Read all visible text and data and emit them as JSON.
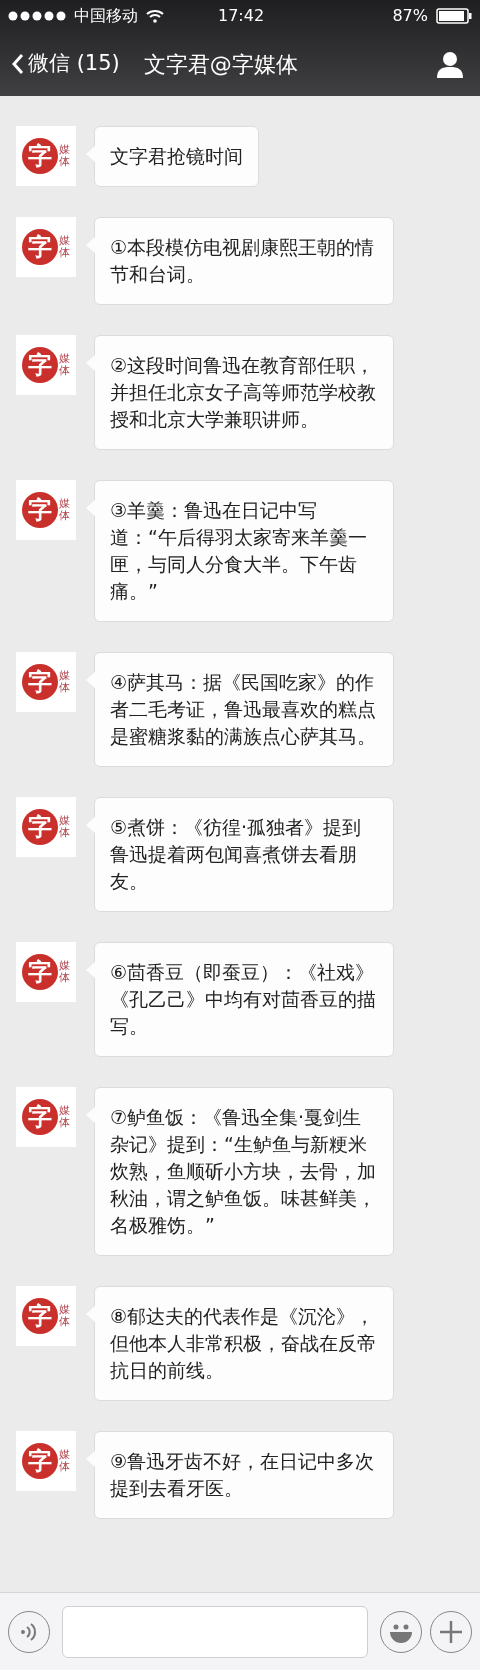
{
  "status_bar": {
    "carrier": "中国移动",
    "time": "17:42",
    "battery": "87%"
  },
  "nav_bar": {
    "back": "微信 (15)",
    "title": "文字君@字媒体"
  },
  "messages": [
    {
      "avatar": {
        "mark": "字",
        "side": "媒体"
      },
      "text": "文字君抢镜时间"
    },
    {
      "avatar": {
        "mark": "字",
        "side": "媒体"
      },
      "text": "①本段模仿电视剧康熙王朝的情节和台词。"
    },
    {
      "avatar": {
        "mark": "字",
        "side": "媒体"
      },
      "text": "②这段时间鲁迅在教育部任职，并担任北京女子高等师范学校教授和北京大学兼职讲师。"
    },
    {
      "avatar": {
        "mark": "字",
        "side": "媒体"
      },
      "text": "③羊羹：鲁迅在日记中写道：“午后得羽太家寄来羊羹一匣，与同人分食大半。下午齿痛。”"
    },
    {
      "avatar": {
        "mark": "字",
        "side": "媒体"
      },
      "text": "④萨其马：据《民国吃家》的作者二毛考证，鲁迅最喜欢的糕点是蜜糖浆黏的满族点心萨其马。"
    },
    {
      "avatar": {
        "mark": "字",
        "side": "媒体"
      },
      "text": "⑤煮饼：《彷徨·孤独者》提到鲁迅提着两包闻喜煮饼去看朋友。"
    },
    {
      "avatar": {
        "mark": "字",
        "side": "媒体"
      },
      "text": "⑥茴香豆（即蚕豆）：《社戏》《孔乙己》中均有对茴香豆的描写。"
    },
    {
      "avatar": {
        "mark": "字",
        "side": "媒体"
      },
      "text": "⑦鲈鱼饭：《鲁迅全集·戛剑生杂记》提到：“生鲈鱼与新粳米炊熟，鱼顺斫小方块，去骨，加秋油，谓之鲈鱼饭。味甚鲜美，名极雅饬。”"
    },
    {
      "avatar": {
        "mark": "字",
        "side": "媒体"
      },
      "text": "⑧郁达夫的代表作是《沉沦》，但他本人非常积极，奋战在反帝抗日的前线。"
    },
    {
      "avatar": {
        "mark": "字",
        "side": "媒体"
      },
      "text": "⑨鲁迅牙齿不好，在日记中多次提到去看牙医。"
    }
  ]
}
